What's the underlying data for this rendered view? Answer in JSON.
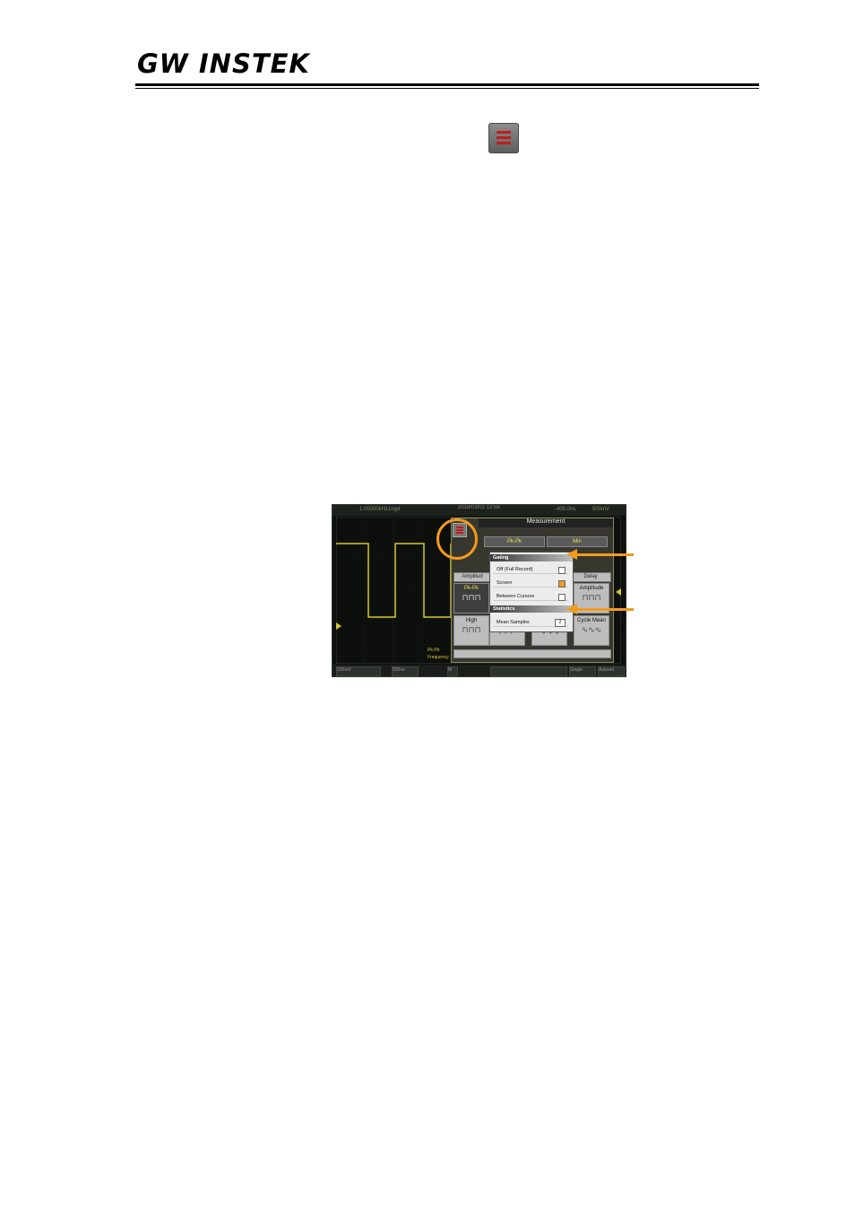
{
  "header": {
    "logo_text": "GW INSTEK"
  },
  "icons": {
    "menu_icon": "menu-icon (hamburger, red bars on grey)"
  },
  "screenshot": {
    "topbar": {
      "left": "1.00000kHz",
      "mid1": "1ngd",
      "date": "2018/03/02 13:58",
      "right1": "-400.0ns",
      "right2": "500mV"
    },
    "panel_title": "Measurement",
    "buttons": {
      "pkpk": "Pk-Pk",
      "min": "Min"
    },
    "tabs": {
      "amplitude": "Amplitud",
      "delay": "Delay"
    },
    "tiles": {
      "pkpk": "Pk-Pk",
      "amplitude": "Amplitude",
      "high": "High",
      "cycle_mean": "Cycle Mean"
    },
    "popup": {
      "gating_header": "Gating",
      "off_full_record": "Off (Full Record)",
      "screen": "Screen",
      "between_cursors": "Between Cursors",
      "statistics_header": "Statistics",
      "mean_samples": "Mean Samples",
      "mean_samples_value": "2"
    },
    "legend": {
      "item1": "Pk-Pk",
      "item2": "Frequency"
    },
    "bottom": {
      "ch1": "500mV",
      "timebase": "500ns",
      "mode": "M",
      "trigger": "Single",
      "auto": "Autoset"
    }
  },
  "colors": {
    "accent": "#f39a1c",
    "trace": "#d6c92a",
    "menu_bar": "#c31b1b"
  }
}
